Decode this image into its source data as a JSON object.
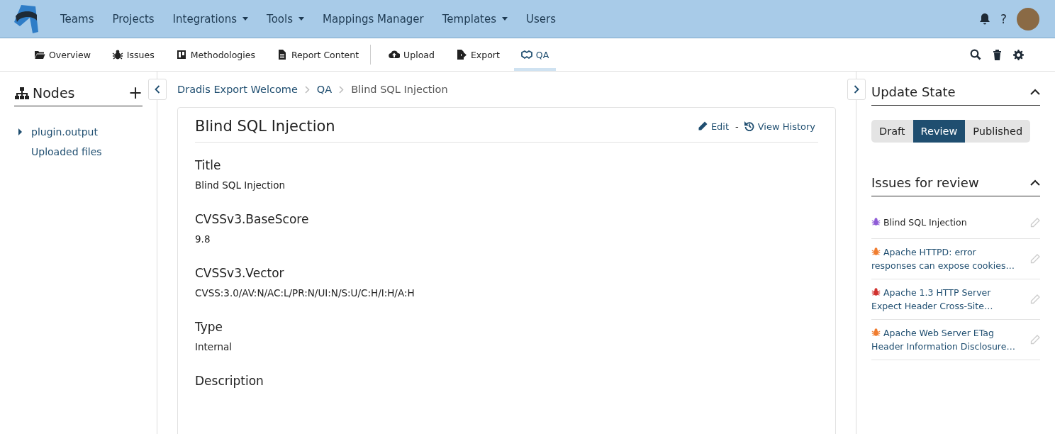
{
  "top_nav": [
    {
      "label": "Teams",
      "dropdown": false
    },
    {
      "label": "Projects",
      "dropdown": false
    },
    {
      "label": "Integrations",
      "dropdown": true
    },
    {
      "label": "Tools",
      "dropdown": true
    },
    {
      "label": "Mappings Manager",
      "dropdown": false
    },
    {
      "label": "Templates",
      "dropdown": true
    },
    {
      "label": "Users",
      "dropdown": false
    }
  ],
  "help": "?",
  "sub_nav": [
    {
      "label": "Overview",
      "kind": "folder",
      "selected": false
    },
    {
      "label": "Issues",
      "kind": "bug",
      "selected": false
    },
    {
      "label": "Methodologies",
      "kind": "board",
      "selected": false
    },
    {
      "label": "Report Content",
      "kind": "file",
      "selected": false
    },
    {
      "label": "Upload",
      "kind": "upload",
      "selected": false,
      "divider": true
    },
    {
      "label": "Export",
      "kind": "export",
      "selected": false
    },
    {
      "label": "QA",
      "kind": "handshake",
      "selected": true
    }
  ],
  "sidebar": {
    "title": "Nodes",
    "add": "+",
    "items": [
      {
        "label": "plugin.output",
        "expandable": true
      },
      {
        "label": "Uploaded files",
        "expandable": false
      }
    ]
  },
  "breadcrumb": [
    "Dradis Export Welcome",
    "QA",
    "Blind SQL Injection"
  ],
  "issue": {
    "title": "Blind SQL Injection",
    "edit": "Edit",
    "separator": "-",
    "history": "View History",
    "fields": [
      {
        "name": "Title",
        "value": "Blind SQL Injection"
      },
      {
        "name": "CVSSv3.BaseScore",
        "value": "9.8"
      },
      {
        "name": "CVSSv3.Vector",
        "value": "CVSS:3.0/AV:N/AC:L/PR:N/UI:N/S:U/C:H/I:H/A:H"
      },
      {
        "name": "Type",
        "value": "Internal"
      },
      {
        "name": "Description"
      }
    ]
  },
  "update_state": {
    "title": "Update State",
    "states": [
      {
        "label": "Draft",
        "selected": false
      },
      {
        "label": "Review",
        "selected": true
      },
      {
        "label": "Published",
        "selected": false
      }
    ]
  },
  "review": {
    "title": "Issues for review",
    "issues": [
      {
        "label": "Blind SQL Injection",
        "color": "#8e5bd6",
        "selected": true
      },
      {
        "label": "Apache HTTPD: error responses can expose cookies…",
        "color": "#f07c2e",
        "selected": false
      },
      {
        "label": "Apache 1.3 HTTP Server Expect Header Cross-Site…",
        "color": "#d0312d",
        "selected": false
      },
      {
        "label": "Apache Web Server ETag Header Information Disclosure…",
        "color": "#f07c2e",
        "selected": false
      }
    ]
  }
}
